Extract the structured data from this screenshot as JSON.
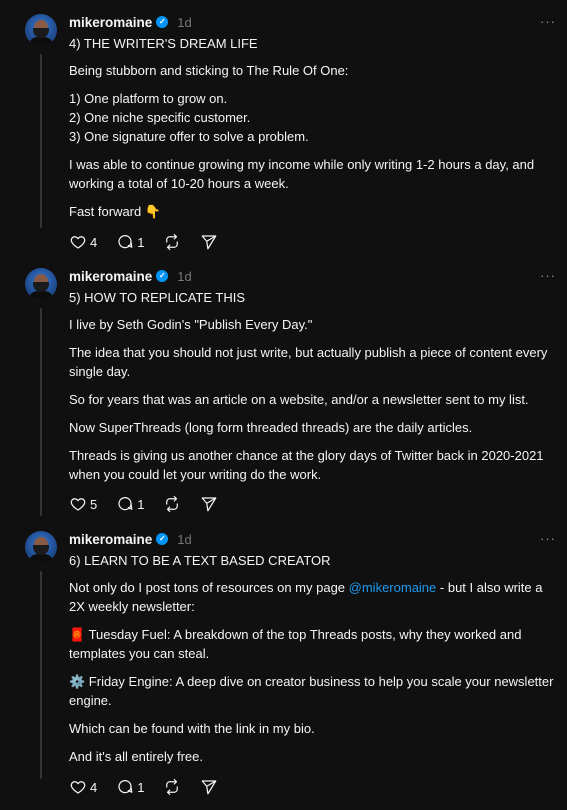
{
  "posts": [
    {
      "username": "mikeromaine",
      "time": "1d",
      "more": "···",
      "paragraphs": [
        "4) THE WRITER'S DREAM LIFE",
        "Being stubborn and sticking to The Rule Of One:",
        "1) One platform to grow on.\n2) One niche specific customer.\n3) One signature offer to solve a problem.",
        "I was able to continue growing my income while only writing 1-2 hours a day, and working a total of 10-20 hours a week.",
        "Fast forward 👇"
      ],
      "likes": "4",
      "replies": "1"
    },
    {
      "username": "mikeromaine",
      "time": "1d",
      "more": "···",
      "paragraphs": [
        "5) HOW TO REPLICATE THIS",
        "I live by Seth Godin's \"Publish Every Day.\"",
        "The idea that you should not just write, but actually publish a piece of content every single day.",
        "So for years that was an article on a website, and/or a newsletter sent to my list.",
        "Now SuperThreads (long form threaded threads) are the daily articles.",
        "Threads is giving us another chance at the glory days of Twitter back in 2020-2021 when you could let your writing do the work."
      ],
      "likes": "5",
      "replies": "1"
    },
    {
      "username": "mikeromaine",
      "time": "1d",
      "more": "···",
      "title": "6) LEARN TO BE A TEXT BASED CREATOR",
      "intro_before": "Not only do I post tons of resources on my page ",
      "mention": "@mikeromaine",
      "intro_after": " - but I also write a 2X weekly newsletter:",
      "paragraphs": [
        "🧧 Tuesday Fuel: A breakdown of the top Threads posts, why they worked and templates you can steal.",
        "⚙️ Friday Engine: A deep dive on creator business to help you scale your newsletter engine.",
        "Which can be found with the link in my bio.",
        "And it's all entirely free."
      ],
      "likes": "4",
      "replies": "1"
    }
  ],
  "icons": {
    "like": "heart-icon",
    "reply": "comment-icon",
    "repost": "repost-icon",
    "share": "send-icon",
    "verified": "verified-badge-icon",
    "more": "more-options-icon"
  },
  "colors": {
    "background": "#101010",
    "text": "#f3f5f7",
    "muted": "#777777",
    "mention": "#1d9bf0",
    "verified": "#0095f6",
    "thread_line": "#333638"
  }
}
